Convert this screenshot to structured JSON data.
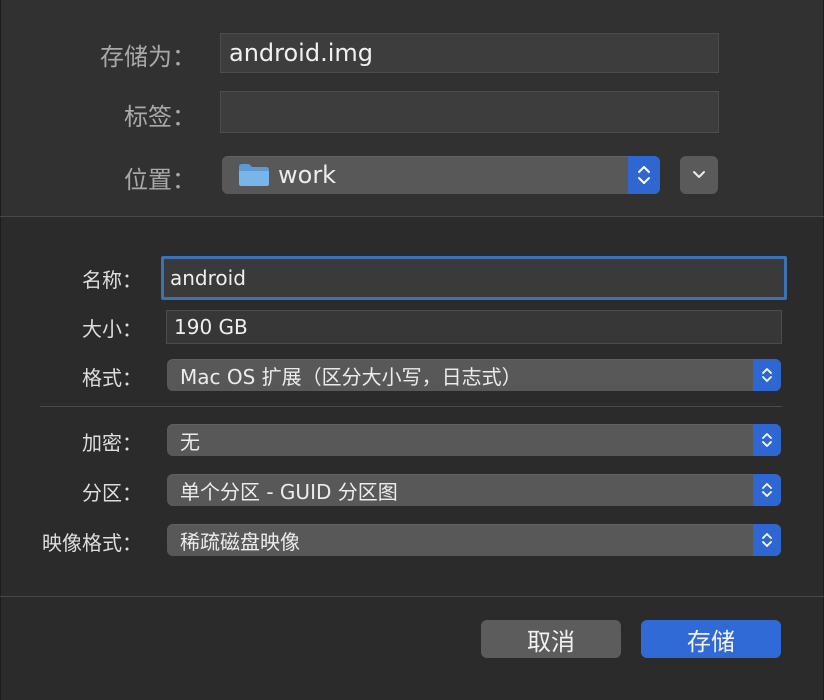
{
  "save_panel": {
    "save_as_label": "存储为：",
    "save_as_value": "android.img",
    "tags_label": "标签：",
    "tags_value": "",
    "location_label": "位置：",
    "location_value": "work"
  },
  "options": {
    "name_label": "名称：",
    "name_value": "android",
    "size_label": "大小：",
    "size_value": "190 GB",
    "format_label": "格式：",
    "format_value": "Mac OS 扩展（区分大小写，日志式）",
    "encryption_label": "加密：",
    "encryption_value": "无",
    "partition_label": "分区：",
    "partition_value": "单个分区 - GUID 分区图",
    "image_format_label": "映像格式：",
    "image_format_value": "稀疏磁盘映像"
  },
  "buttons": {
    "cancel": "取消",
    "save": "存储"
  },
  "icons": {
    "folder": "folder-icon",
    "stepper": "up-down-chevron-icon",
    "expand": "chevron-down-icon"
  },
  "colors": {
    "accent": "#2e67d1",
    "focus_ring": "#3b73b4",
    "folder": "#6aa8df"
  }
}
